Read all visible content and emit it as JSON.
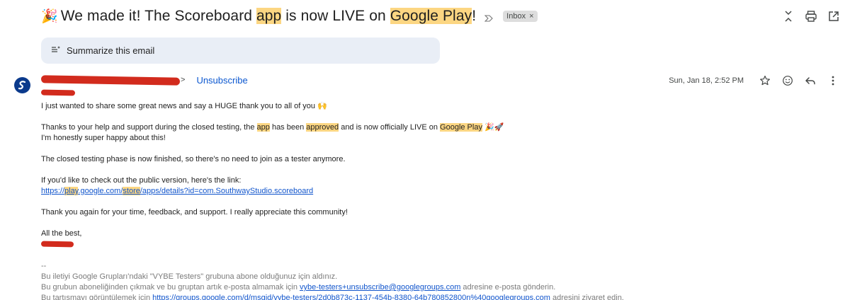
{
  "subject": {
    "emoji": "🎉",
    "part1": "We made it! The Scoreboard ",
    "hl1": "app",
    "part2": " is now LIVE on ",
    "hl2": "Google Play",
    "part3": "!",
    "label": "Inbox",
    "label_close": "×"
  },
  "summarize": {
    "label": "Summarize this email"
  },
  "sender": {
    "arrow": ">",
    "unsubscribe": "Unsubscribe"
  },
  "meta": {
    "date": "Sun, Jan 18, 2:52 PM"
  },
  "body": {
    "line1": "I just wanted to share some great news and say a HUGE thank you to all of you 🙌",
    "l2a": "Thanks to your help and support during the closed testing, the ",
    "l2_hl1": "app",
    "l2b": " has been ",
    "l2_hl2": "approved",
    "l2c": " and is now officially LIVE on ",
    "l2_hl3": "Google Play",
    "l2d": " 🎉🚀",
    "line3": "I'm honestly super happy about this!",
    "line4": "The closed testing phase is now finished, so there's no need to join as a tester anymore.",
    "line5": "If you'd like to check out the public version, here's the link:",
    "link_a": "https://",
    "link_hl1": "play",
    "link_b": ".google.com/",
    "link_hl2": "store",
    "link_c": "/apps/details?id=com.SouthwayStudio.scoreboard",
    "line6": "Thank you again for your time, feedback, and support. I really appreciate this community!",
    "line7": "All the best,"
  },
  "footer": {
    "sep": "--",
    "f1": "Bu iletiyi Google Grupları'ndaki \"VYBE Testers\" grubuna abone olduğunuz için aldınız.",
    "f2a": "Bu grubun aboneliğinden çıkmak ve bu gruptan artık e-posta almamak için ",
    "f2_link": "vybe-testers+unsubscribe@googlegroups.com",
    "f2b": " adresine e-posta gönderin.",
    "f3a": "Bu tartışmayı görüntülemek için ",
    "f3_link": "https://groups.google.com/d/msgid/vybe-testers/2d0b873c-1137-454b-8380-64b780852800n%40googlegroups.com",
    "f3b": " adresini ziyaret edin."
  },
  "icons": {
    "top": [
      "expand-collapse-icon",
      "print-icon",
      "open-in-new-window-icon"
    ],
    "meta": [
      "star-icon",
      "emoji-reaction-icon",
      "reply-icon",
      "more-vert-icon"
    ]
  },
  "colors": {
    "highlight": "#fcd682",
    "link": "#1155cc",
    "summarize_bg": "#e9eef6",
    "avatar": "#0b3a8c",
    "redaction": "#d22b1d"
  }
}
